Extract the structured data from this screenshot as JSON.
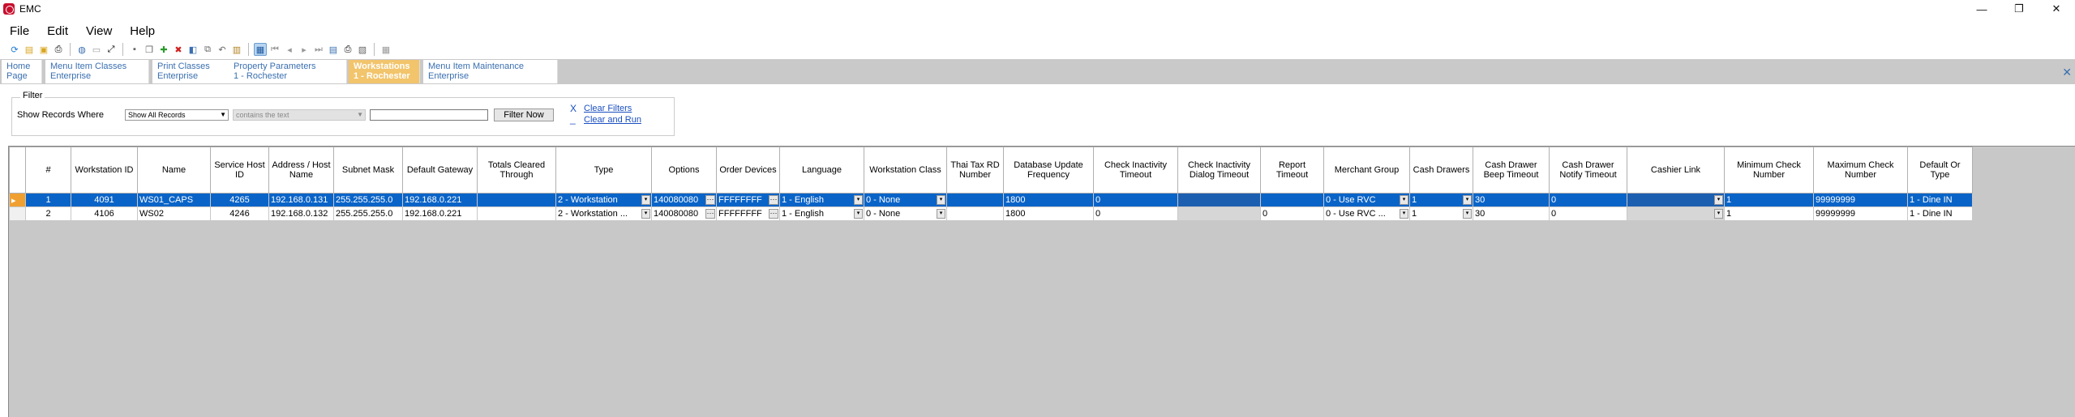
{
  "window": {
    "title": "EMC",
    "controls": [
      "—",
      "❐",
      "✕"
    ]
  },
  "menu": [
    "File",
    "Edit",
    "View",
    "Help"
  ],
  "tabs": [
    {
      "line1": "Home",
      "line2": "Page"
    },
    {
      "line1": "Menu Item Classes",
      "line2": "Enterprise"
    },
    {
      "line1": "Print Classes",
      "line2": "Enterprise"
    },
    {
      "line1": "Property Parameters",
      "line2": "1 - Rochester"
    },
    {
      "line1": "Workstations",
      "line2": "1 - Rochester"
    },
    {
      "line1": "Menu Item Maintenance",
      "line2": "Enterprise"
    }
  ],
  "filter": {
    "legend": "Filter",
    "label": "Show Records Where",
    "field_select": "Show All Records",
    "operator_select": "contains the text",
    "text_value": "",
    "button": "Filter Now",
    "clear_filters": "Clear Filters",
    "clear_and_run": "Clear and Run"
  },
  "grid": {
    "columns": [
      "",
      "#",
      "Workstation ID",
      "Name",
      "Service Host ID",
      "Address / Host Name",
      "Subnet Mask",
      "Default Gateway",
      "Totals Cleared Through",
      "Type",
      "Options",
      "Order Devices",
      "Language",
      "Workstation Class",
      "Thai Tax RD Number",
      "Database Update Frequency",
      "Check Inactivity Timeout",
      "Check Inactivity Dialog Timeout",
      "Report Timeout",
      "Merchant Group",
      "Cash Drawers",
      "Cash Drawer Beep Timeout",
      "Cash Drawer Notify Timeout",
      "Cashier Link",
      "Minimum Check Number",
      "Maximum Check Number",
      "Default Or Type"
    ],
    "rows": [
      {
        "num": "1",
        "ws_id": "4091",
        "name": "WS01_CAPS",
        "host_id": "4265",
        "address": "192.168.0.131",
        "subnet": "255.255.255.0",
        "gateway": "192.168.0.221",
        "totals": "",
        "type": "2 - Workstation",
        "options": "140080080",
        "order_devices": "FFFFFFFF",
        "language": "1 - English",
        "ws_class": "0 - None",
        "thai_tax": "",
        "db_update": "1800",
        "chk_inact": "0",
        "chk_dialog": "",
        "report_timeout": "",
        "merchant": "0 - Use RVC",
        "cash_drawers": "1",
        "beep": "30",
        "notify": "0",
        "cashier_link": "",
        "min_check": "1",
        "max_check": "99999999",
        "default_or": "1 - Dine IN"
      },
      {
        "num": "2",
        "ws_id": "4106",
        "name": "WS02",
        "host_id": "4246",
        "address": "192.168.0.132",
        "subnet": "255.255.255.0",
        "gateway": "192.168.0.221",
        "totals": "",
        "type": "2 - Workstation ...",
        "options": "140080080",
        "order_devices": "FFFFFFFF",
        "language": "1 - English",
        "ws_class": "0 - None",
        "thai_tax": "",
        "db_update": "1800",
        "chk_inact": "0",
        "chk_dialog": "",
        "report_timeout": "0",
        "merchant": "0 - Use RVC ...",
        "cash_drawers": "1",
        "beep": "30",
        "notify": "0",
        "cashier_link": "",
        "min_check": "1",
        "max_check": "99999999",
        "default_or": "1 - Dine IN"
      }
    ]
  },
  "icons": {
    "close_tab": "✕",
    "ellipsis": "···",
    "dropdown": "▾",
    "row_pointer": "▸"
  }
}
